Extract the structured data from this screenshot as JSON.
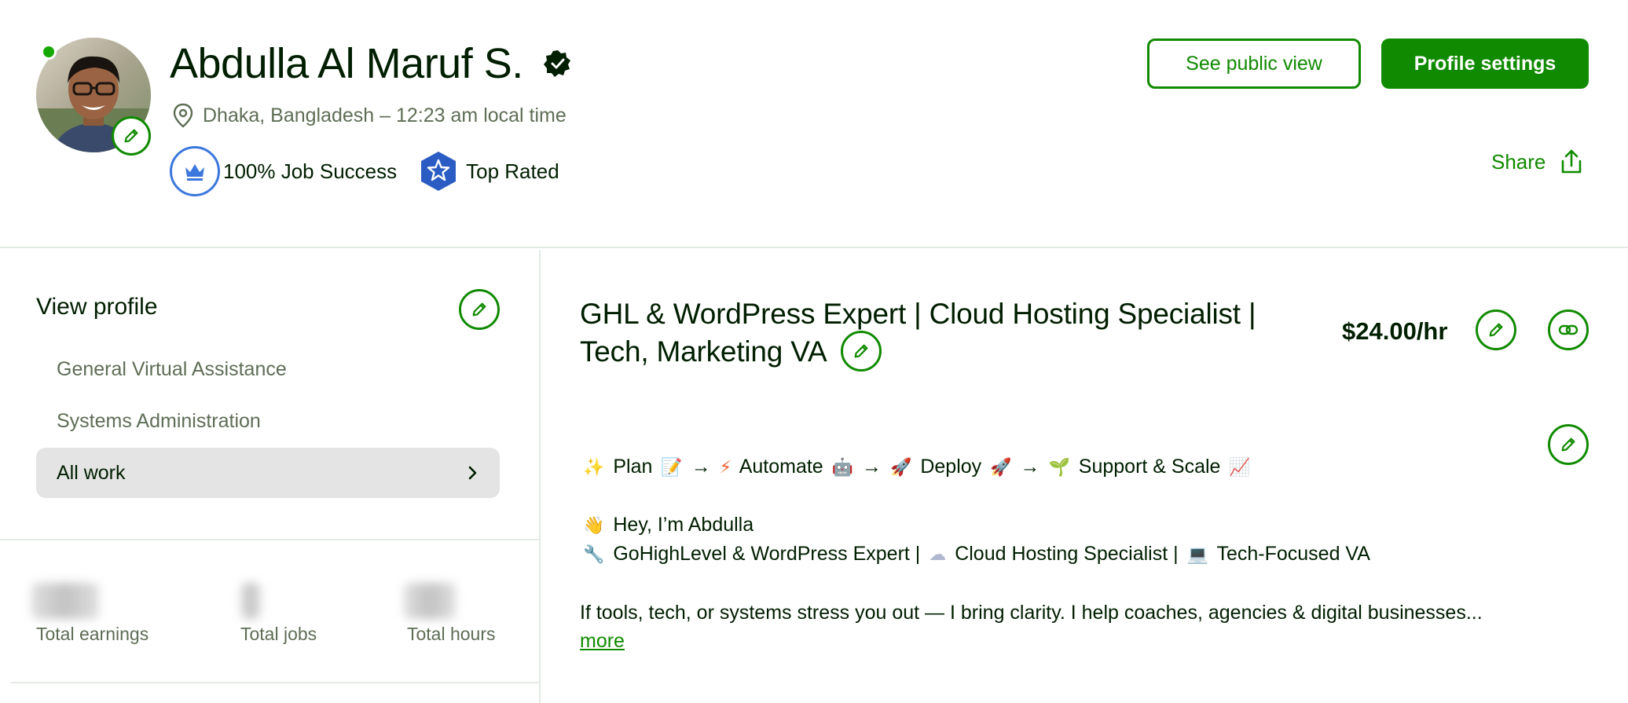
{
  "profile": {
    "name": "Abdulla Al Maruf S.",
    "location": "Dhaka, Bangladesh – 12:23 am local time",
    "job_success": "100% Job Success",
    "top_rated": "Top Rated"
  },
  "actions": {
    "public_view": "See public view",
    "settings": "Profile settings",
    "share": "Share"
  },
  "sidebar": {
    "title": "View profile",
    "items": [
      {
        "label": "General Virtual Assistance"
      },
      {
        "label": "Systems Administration"
      },
      {
        "label": "All work"
      }
    ]
  },
  "stats": [
    {
      "label": "Total earnings"
    },
    {
      "label": "Total jobs"
    },
    {
      "label": "Total hours"
    }
  ],
  "main": {
    "headline_line1": "GHL & WordPress Expert | Cloud Hosting Specialist |",
    "headline_line2": "Tech, Marketing VA",
    "rate": "$24.00/hr",
    "desc": {
      "plan": "Plan",
      "automate": "Automate",
      "deploy": "Deploy",
      "support": "Support & Scale",
      "greeting": "Hey, I’m Abdulla",
      "skill1": "GoHighLevel & WordPress Expert |",
      "skill2": "Cloud Hosting Specialist |",
      "skill3": "Tech-Focused VA",
      "intro": "If tools, tech, or systems stress you out — I bring clarity. I help coaches, agencies & digital businesses...",
      "more": "more"
    }
  },
  "colors": {
    "brand_green": "#108a00",
    "text_dark": "#001e00",
    "text_muted": "#5e6d55",
    "online": "#14a800",
    "badge_blue": "#3c77dd"
  }
}
